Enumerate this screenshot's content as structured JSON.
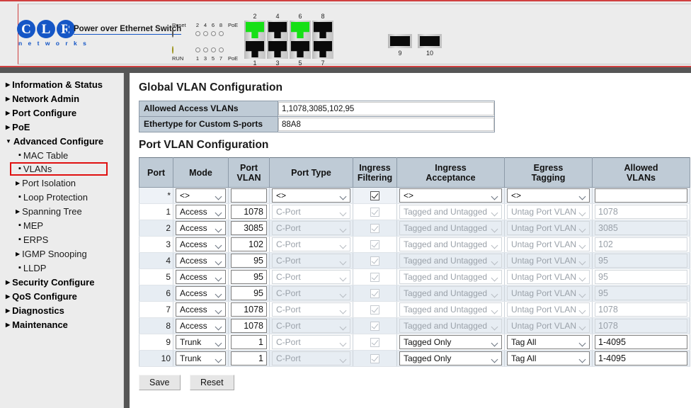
{
  "device_banner": {
    "brand": "CLR",
    "brand_letters": [
      "C",
      "L",
      "R"
    ],
    "brand_sub": "n e t w o r k s",
    "tagline": "Power over Ethernet Switch",
    "led_reset_label": "Reset",
    "led_run_label": "RUN",
    "led_poe_label": "PoE",
    "led_top_numbers": [
      "2",
      "4",
      "6",
      "8"
    ],
    "led_bottom_numbers": [
      "1",
      "3",
      "5",
      "7"
    ],
    "ports": [
      {
        "top_num": "2",
        "bottom_num": "1",
        "top_lit": true,
        "bottom_lit": false
      },
      {
        "top_num": "4",
        "bottom_num": "3",
        "top_lit": false,
        "bottom_lit": false
      },
      {
        "top_num": "6",
        "bottom_num": "5",
        "top_lit": true,
        "bottom_lit": false
      },
      {
        "top_num": "8",
        "bottom_num": "7",
        "top_lit": false,
        "bottom_lit": false
      }
    ],
    "sfp_ports": [
      {
        "num": "9"
      },
      {
        "num": "10"
      }
    ]
  },
  "sidebar": {
    "items": [
      {
        "label": "Information & Status",
        "level": "top",
        "marker": "tri-right"
      },
      {
        "label": "Network Admin",
        "level": "top",
        "marker": "tri-right"
      },
      {
        "label": "Port Configure",
        "level": "top",
        "marker": "tri-right"
      },
      {
        "label": "PoE",
        "level": "top",
        "marker": "tri-right"
      },
      {
        "label": "Advanced Configure",
        "level": "top",
        "marker": "tri-down"
      },
      {
        "label": "MAC Table",
        "level": "sub",
        "marker": "sq"
      },
      {
        "label": "VLANs",
        "level": "sub",
        "marker": "sq",
        "selected": true
      },
      {
        "label": "Port Isolation",
        "level": "sub2",
        "marker": "tri-right"
      },
      {
        "label": "Loop Protection",
        "level": "sub",
        "marker": "sq"
      },
      {
        "label": "Spanning Tree",
        "level": "sub2",
        "marker": "tri-right"
      },
      {
        "label": "MEP",
        "level": "sub",
        "marker": "sq"
      },
      {
        "label": "ERPS",
        "level": "sub",
        "marker": "sq"
      },
      {
        "label": "IGMP Snooping",
        "level": "sub2",
        "marker": "tri-right"
      },
      {
        "label": "LLDP",
        "level": "sub",
        "marker": "sq"
      },
      {
        "label": "Security Configure",
        "level": "top",
        "marker": "tri-right"
      },
      {
        "label": "QoS Configure",
        "level": "top",
        "marker": "tri-right"
      },
      {
        "label": "Diagnostics",
        "level": "top",
        "marker": "tri-right"
      },
      {
        "label": "Maintenance",
        "level": "top",
        "marker": "tri-right"
      }
    ],
    "highlight_color": "#e01010"
  },
  "content": {
    "global_title": "Global VLAN Configuration",
    "global_rows": [
      {
        "label": "Allowed Access VLANs",
        "value": "1,1078,3085,102,95"
      },
      {
        "label": "Ethertype for Custom S-ports",
        "value": "88A8"
      }
    ],
    "port_title": "Port VLAN Configuration",
    "columns": [
      "Port",
      "Mode",
      "Port VLAN",
      "Port Type",
      "Ingress Filtering",
      "Ingress Acceptance",
      "Egress Tagging",
      "Allowed VLANs"
    ],
    "columns_multiline": [
      [
        "Port"
      ],
      [
        "Mode"
      ],
      [
        "Port",
        "VLAN"
      ],
      [
        "Port Type"
      ],
      [
        "Ingress",
        "Filtering"
      ],
      [
        "Ingress",
        "Acceptance"
      ],
      [
        "Egress",
        "Tagging"
      ],
      [
        "Allowed",
        "VLANs"
      ]
    ],
    "star_row": {
      "port": "*",
      "mode": "<>",
      "port_vlan": "",
      "port_type": "<>",
      "ingress_filtering": true,
      "ingress_acceptance": "<>",
      "egress_tagging": "<>",
      "allowed_vlans": ""
    },
    "rows": [
      {
        "port": "1",
        "mode": "Access",
        "port_vlan": "1078",
        "port_type": "C-Port",
        "ingress_filtering": true,
        "ingress_acceptance": "Tagged and Untagged",
        "egress_tagging": "Untag Port VLAN",
        "allowed_vlans": "1078",
        "disabled": true
      },
      {
        "port": "2",
        "mode": "Access",
        "port_vlan": "3085",
        "port_type": "C-Port",
        "ingress_filtering": true,
        "ingress_acceptance": "Tagged and Untagged",
        "egress_tagging": "Untag Port VLAN",
        "allowed_vlans": "3085",
        "disabled": true
      },
      {
        "port": "3",
        "mode": "Access",
        "port_vlan": "102",
        "port_type": "C-Port",
        "ingress_filtering": true,
        "ingress_acceptance": "Tagged and Untagged",
        "egress_tagging": "Untag Port VLAN",
        "allowed_vlans": "102",
        "disabled": true
      },
      {
        "port": "4",
        "mode": "Access",
        "port_vlan": "95",
        "port_type": "C-Port",
        "ingress_filtering": true,
        "ingress_acceptance": "Tagged and Untagged",
        "egress_tagging": "Untag Port VLAN",
        "allowed_vlans": "95",
        "disabled": true
      },
      {
        "port": "5",
        "mode": "Access",
        "port_vlan": "95",
        "port_type": "C-Port",
        "ingress_filtering": true,
        "ingress_acceptance": "Tagged and Untagged",
        "egress_tagging": "Untag Port VLAN",
        "allowed_vlans": "95",
        "disabled": true
      },
      {
        "port": "6",
        "mode": "Access",
        "port_vlan": "95",
        "port_type": "C-Port",
        "ingress_filtering": true,
        "ingress_acceptance": "Tagged and Untagged",
        "egress_tagging": "Untag Port VLAN",
        "allowed_vlans": "95",
        "disabled": true
      },
      {
        "port": "7",
        "mode": "Access",
        "port_vlan": "1078",
        "port_type": "C-Port",
        "ingress_filtering": true,
        "ingress_acceptance": "Tagged and Untagged",
        "egress_tagging": "Untag Port VLAN",
        "allowed_vlans": "1078",
        "disabled": true
      },
      {
        "port": "8",
        "mode": "Access",
        "port_vlan": "1078",
        "port_type": "C-Port",
        "ingress_filtering": true,
        "ingress_acceptance": "Tagged and Untagged",
        "egress_tagging": "Untag Port VLAN",
        "allowed_vlans": "1078",
        "disabled": true
      },
      {
        "port": "9",
        "mode": "Trunk",
        "port_vlan": "1",
        "port_type": "C-Port",
        "ingress_filtering": true,
        "ingress_acceptance": "Tagged Only",
        "egress_tagging": "Tag All",
        "allowed_vlans": "1-4095",
        "disabled": false
      },
      {
        "port": "10",
        "mode": "Trunk",
        "port_vlan": "1",
        "port_type": "C-Port",
        "ingress_filtering": true,
        "ingress_acceptance": "Tagged Only",
        "egress_tagging": "Tag All",
        "allowed_vlans": "1-4095",
        "disabled": false
      }
    ],
    "buttons": {
      "save": "Save",
      "reset": "Reset"
    }
  }
}
